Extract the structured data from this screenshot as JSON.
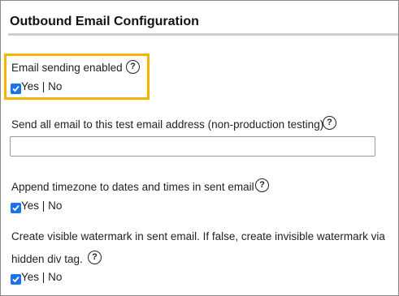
{
  "section": {
    "title": "Outbound Email Configuration"
  },
  "settings": [
    {
      "label": "Email sending enabled",
      "help": "?",
      "yes": "Yes",
      "sep": "|",
      "no": "No",
      "checked": true
    },
    {
      "label": "Send all email to this test email address (non-production testing)",
      "help": "?",
      "value": ""
    },
    {
      "label": "Append timezone to dates and times in sent email",
      "help": "?",
      "yes": "Yes",
      "sep": "|",
      "no": "No",
      "checked": true
    },
    {
      "label_line1": "Create visible watermark in sent email. If false, create invisible watermark via",
      "label_line2": "hidden div tag.",
      "help": "?",
      "yes": "Yes",
      "sep": "|",
      "no": "No",
      "checked": true
    }
  ],
  "colors": {
    "highlight": "#f4b400",
    "checkbox": "#1a73e8"
  }
}
